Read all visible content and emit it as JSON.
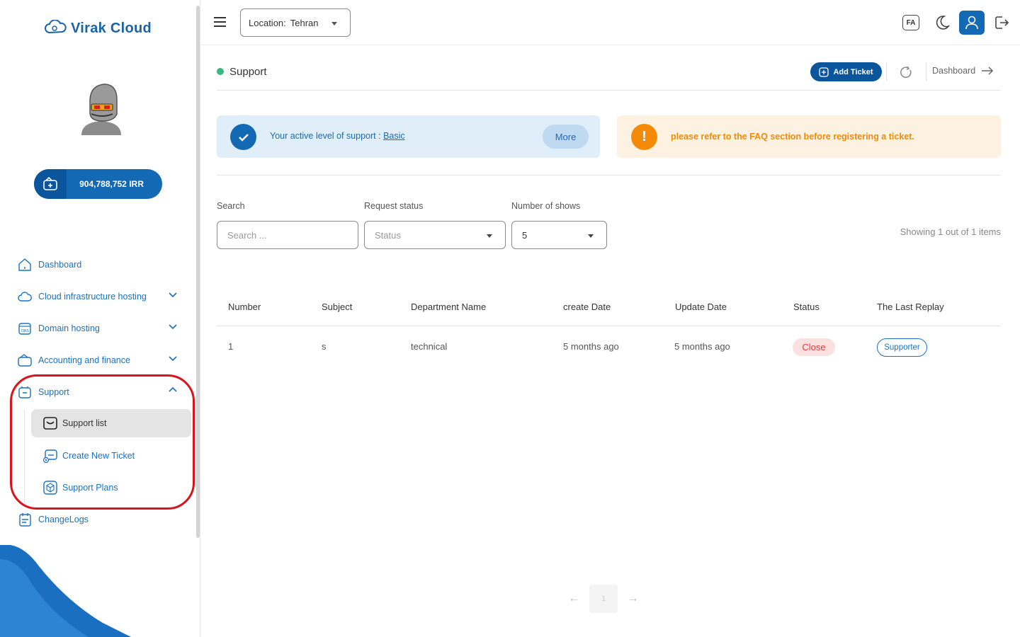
{
  "app": {
    "brand": "Virak Cloud",
    "accent": "#1469b5"
  },
  "sidebar": {
    "wallet": {
      "amount": "904,788,752 IRR"
    },
    "items": [
      {
        "label": "Dashboard",
        "icon": "home-icon"
      },
      {
        "label": "Cloud infrastructure hosting",
        "icon": "cloud-icon"
      },
      {
        "label": "Domain hosting",
        "icon": "dns-icon"
      },
      {
        "label": "Accounting and finance",
        "icon": "wallet-icon"
      },
      {
        "label": "Support",
        "icon": "support-icon"
      },
      {
        "label": "ChangeLogs",
        "icon": "changelog-icon"
      }
    ],
    "support_sub": [
      {
        "label": "Support list",
        "icon": "inbox-icon"
      },
      {
        "label": "Create New Ticket",
        "icon": "new-ticket-icon"
      },
      {
        "label": "Support Plans",
        "icon": "box-icon"
      }
    ]
  },
  "topbar": {
    "location_label": "Location:",
    "location_value": "Tehran",
    "lang": "FA"
  },
  "page": {
    "title": "Support",
    "add_ticket": "Add Ticket",
    "dashboard_link": "Dashboard",
    "alert_support_prefix": "Your active level of support :",
    "alert_support_level": "Basic",
    "more": "More",
    "alert_faq": "please refer to the FAQ section before registering a ticket."
  },
  "filters": {
    "search_label": "Search",
    "search_placeholder": "Search ...",
    "status_label": "Request status",
    "status_placeholder": "Status",
    "shows_label": "Number of shows",
    "shows_value": "5",
    "showing_text": "Showing 1 out of 1 items"
  },
  "table": {
    "headers": [
      "Number",
      "Subject",
      "Department Name",
      "create Date",
      "Update Date",
      "Status",
      "The Last Replay"
    ],
    "rows": [
      {
        "number": "1",
        "subject": "s",
        "department": "technical",
        "created": "5 months ago",
        "updated": "5 months ago",
        "status": "Close",
        "last_reply": "Supporter"
      }
    ]
  },
  "pagination": {
    "current": "1"
  }
}
